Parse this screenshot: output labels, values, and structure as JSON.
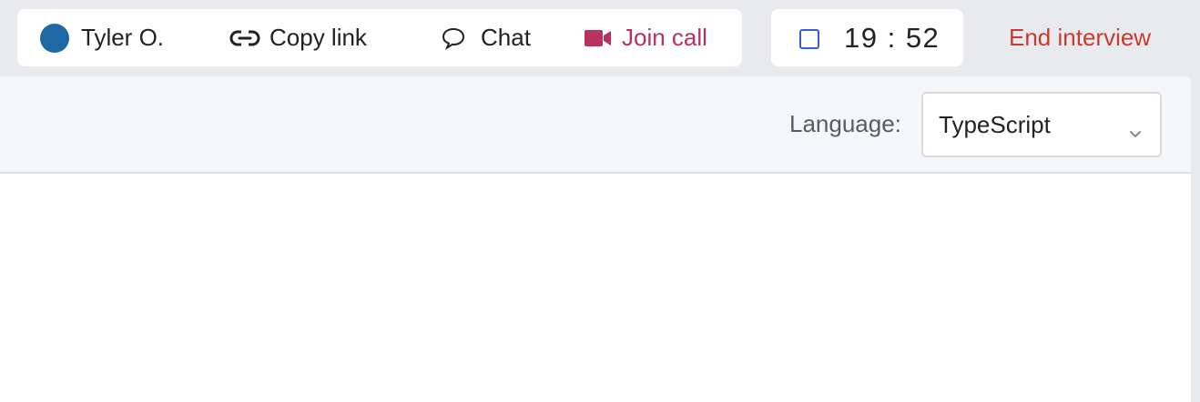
{
  "topbar": {
    "user": {
      "name": "Tyler O.",
      "avatar_color": "#1f68a6",
      "icon": "avatar"
    },
    "copy_link": {
      "label": "Copy link",
      "icon": "link-icon"
    },
    "chat": {
      "label": "Chat",
      "icon": "speech-bubble-icon"
    },
    "join_call": {
      "label": "Join call",
      "icon": "video-camera-icon",
      "color": "#b8315f"
    },
    "timer": {
      "value": "19 : 52",
      "icon": "square-stop-icon",
      "icon_color": "#3b5bd6"
    },
    "end_interview": {
      "label": "End interview",
      "color": "#c93a30"
    }
  },
  "editor": {
    "language_label": "Language:",
    "language_select": {
      "value": "TypeScript",
      "icon": "chevron-down-icon"
    }
  }
}
